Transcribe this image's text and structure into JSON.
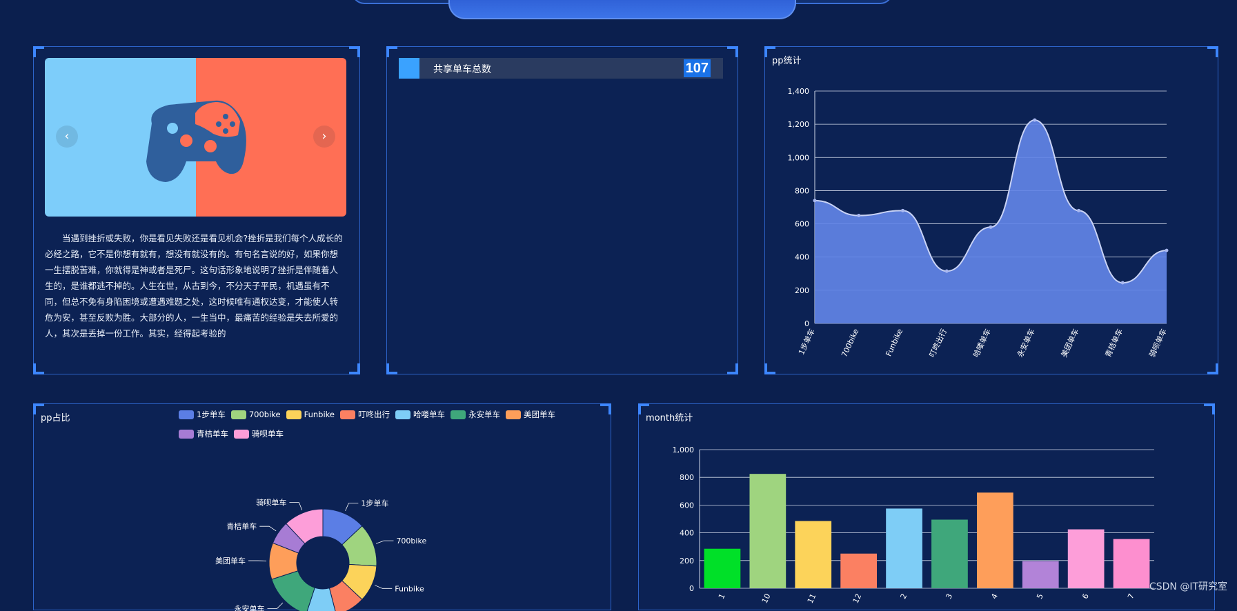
{
  "panels": {
    "carousel_text": "当遇到挫折或失败，你是看见失败还是看见机会?挫折是我们每个人成长的必经之路，它不是你想有就有，想没有就没有的。有句名言说的好，如果你想一生摆脱苦难，你就得是神或者是死尸。这句话形象地说明了挫折是伴随着人生的，是谁都逃不掉的。人生在世，从古到今，不分天子平民，机遇虽有不同，但总不免有身陷困境或遭遇难题之处，这时候唯有通权达变，才能使人转危为安，甚至反败为胜。大部分的人，一生当中，最痛苦的经验是失去所爱的人，其次是丢掉一份工作。其实，经得起考验的",
    "carousel_prev": "‹",
    "carousel_next": "›",
    "stat_label": "共享单车总数",
    "stat_value": "107",
    "pp_title": "pp统计",
    "pie_title": "pp占比",
    "month_title": "month统计"
  },
  "watermark": "CSDN @IT研究室",
  "colors": {
    "pie": [
      "#5b7ee5",
      "#9fd47f",
      "#fcd35a",
      "#fb8062",
      "#7ecdf6",
      "#3fa77b",
      "#fe9e5a",
      "#a77cd4",
      "#fd9ed9"
    ],
    "bars": [
      "#00e028",
      "#9fd47f",
      "#fcd35a",
      "#fb8062",
      "#7ecdf6",
      "#3fa77b",
      "#fe9e5a",
      "#b283d8",
      "#fd9ed9",
      "#fd8fcf"
    ],
    "area": "#6284e6"
  },
  "chart_data": [
    {
      "type": "area",
      "title": "pp统计",
      "categories": [
        "1步单车",
        "700bike",
        "Funbike",
        "叮咚出行",
        "哈喽单车",
        "永安单车",
        "美团单车",
        "青桔单车",
        "骑呗单车"
      ],
      "values": [
        740,
        650,
        680,
        315,
        580,
        1225,
        680,
        245,
        440
      ],
      "ylim": [
        0,
        1400
      ],
      "yticks": [
        "0",
        "200",
        "400",
        "600",
        "800",
        "1,000",
        "1,200",
        "1,400"
      ],
      "grid": true
    },
    {
      "type": "pie",
      "title": "pp占比",
      "legend_position": "top",
      "labels": [
        "1步单车",
        "700bike",
        "Funbike",
        "叮咚出行",
        "哈喽单车",
        "永安单车",
        "美团单车",
        "青桔单车",
        "骑呗单车"
      ],
      "values": [
        13,
        13,
        11,
        9,
        9,
        15,
        11,
        7,
        12
      ],
      "visible_callouts": [
        "1步单车",
        "700bike",
        "Funbike",
        "永安单车",
        "美团单车",
        "青桔单车",
        "骑呗单车"
      ]
    },
    {
      "type": "bar",
      "title": "month统计",
      "categories": [
        "1",
        "10",
        "11",
        "12",
        "2",
        "3",
        "4",
        "5",
        "6",
        "7"
      ],
      "values": [
        285,
        825,
        485,
        250,
        575,
        495,
        690,
        195,
        425,
        355
      ],
      "ylim": [
        0,
        1000
      ],
      "yticks": [
        "0",
        "200",
        "400",
        "600",
        "800",
        "1,000"
      ],
      "grid": true
    }
  ]
}
